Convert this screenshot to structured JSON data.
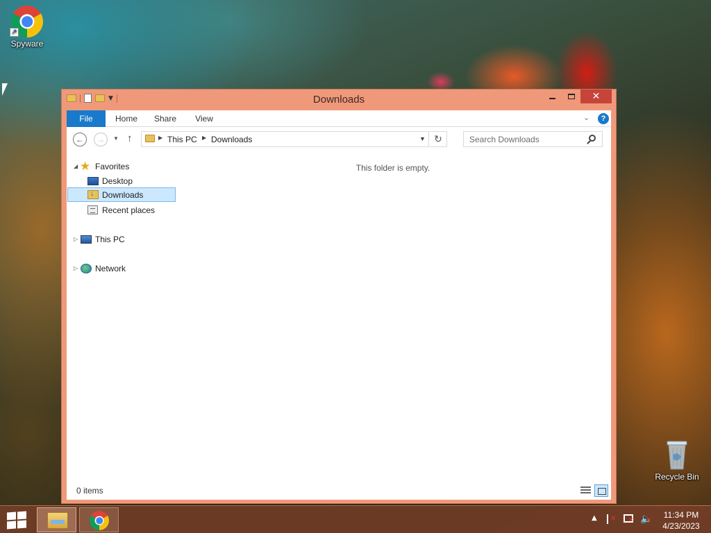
{
  "desktop": {
    "icons": [
      {
        "label": "Spyware",
        "icon": "chrome-icon"
      },
      {
        "label": "Recycle Bin",
        "icon": "recycle-bin-icon"
      }
    ]
  },
  "window": {
    "title": "Downloads",
    "controls": {
      "minimize": "—",
      "maximize": "□",
      "close": "✕"
    },
    "ribbon": {
      "tabs": [
        {
          "label": "File"
        },
        {
          "label": "Home"
        },
        {
          "label": "Share"
        },
        {
          "label": "View"
        }
      ],
      "help": "?"
    },
    "nav": {
      "breadcrumb": [
        "This PC",
        "Downloads"
      ],
      "search_placeholder": "Search Downloads"
    },
    "tree": [
      {
        "label": "Favorites",
        "icon": "star-icon"
      },
      {
        "label": "Desktop",
        "icon": "desktop-icon"
      },
      {
        "label": "Downloads",
        "icon": "downloads-folder-icon",
        "selected": true
      },
      {
        "label": "Recent places",
        "icon": "recent-places-icon"
      },
      {
        "label": "This PC",
        "icon": "this-pc-icon"
      },
      {
        "label": "Network",
        "icon": "network-icon"
      }
    ],
    "content": {
      "empty_message": "This folder is empty."
    },
    "status": {
      "items": "0 items"
    }
  },
  "taskbar": {
    "clock": {
      "time": "11:34 PM",
      "date": "4/23/2023"
    },
    "tray_icons": [
      "show-hidden-icons",
      "action-center-flag-icon",
      "network-icon",
      "volume-muted-icon"
    ],
    "pinned": [
      "file-explorer-icon",
      "chrome-icon"
    ]
  }
}
